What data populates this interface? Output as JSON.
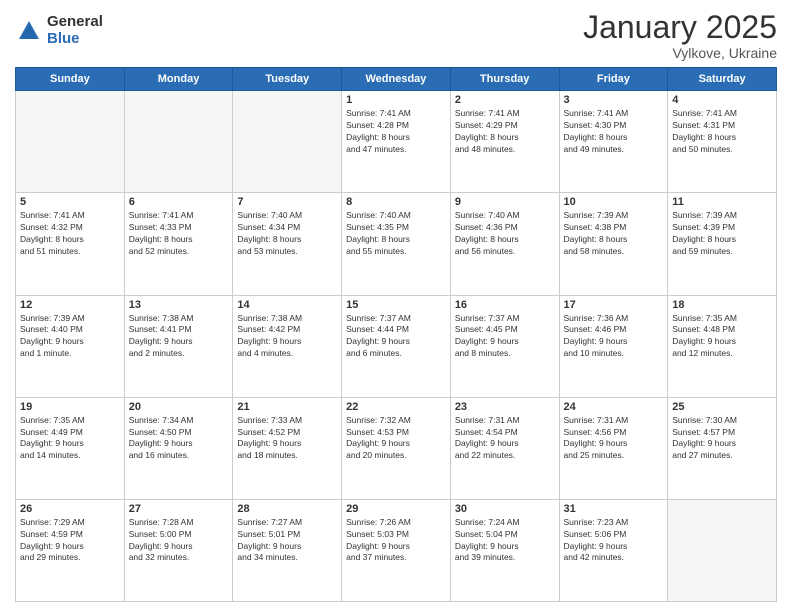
{
  "logo": {
    "general": "General",
    "blue": "Blue"
  },
  "header": {
    "month_year": "January 2025",
    "location": "Vylkove, Ukraine"
  },
  "weekdays": [
    "Sunday",
    "Monday",
    "Tuesday",
    "Wednesday",
    "Thursday",
    "Friday",
    "Saturday"
  ],
  "weeks": [
    [
      {
        "day": "",
        "info": ""
      },
      {
        "day": "",
        "info": ""
      },
      {
        "day": "",
        "info": ""
      },
      {
        "day": "1",
        "info": "Sunrise: 7:41 AM\nSunset: 4:28 PM\nDaylight: 8 hours\nand 47 minutes."
      },
      {
        "day": "2",
        "info": "Sunrise: 7:41 AM\nSunset: 4:29 PM\nDaylight: 8 hours\nand 48 minutes."
      },
      {
        "day": "3",
        "info": "Sunrise: 7:41 AM\nSunset: 4:30 PM\nDaylight: 8 hours\nand 49 minutes."
      },
      {
        "day": "4",
        "info": "Sunrise: 7:41 AM\nSunset: 4:31 PM\nDaylight: 8 hours\nand 50 minutes."
      }
    ],
    [
      {
        "day": "5",
        "info": "Sunrise: 7:41 AM\nSunset: 4:32 PM\nDaylight: 8 hours\nand 51 minutes."
      },
      {
        "day": "6",
        "info": "Sunrise: 7:41 AM\nSunset: 4:33 PM\nDaylight: 8 hours\nand 52 minutes."
      },
      {
        "day": "7",
        "info": "Sunrise: 7:40 AM\nSunset: 4:34 PM\nDaylight: 8 hours\nand 53 minutes."
      },
      {
        "day": "8",
        "info": "Sunrise: 7:40 AM\nSunset: 4:35 PM\nDaylight: 8 hours\nand 55 minutes."
      },
      {
        "day": "9",
        "info": "Sunrise: 7:40 AM\nSunset: 4:36 PM\nDaylight: 8 hours\nand 56 minutes."
      },
      {
        "day": "10",
        "info": "Sunrise: 7:39 AM\nSunset: 4:38 PM\nDaylight: 8 hours\nand 58 minutes."
      },
      {
        "day": "11",
        "info": "Sunrise: 7:39 AM\nSunset: 4:39 PM\nDaylight: 8 hours\nand 59 minutes."
      }
    ],
    [
      {
        "day": "12",
        "info": "Sunrise: 7:39 AM\nSunset: 4:40 PM\nDaylight: 9 hours\nand 1 minute."
      },
      {
        "day": "13",
        "info": "Sunrise: 7:38 AM\nSunset: 4:41 PM\nDaylight: 9 hours\nand 2 minutes."
      },
      {
        "day": "14",
        "info": "Sunrise: 7:38 AM\nSunset: 4:42 PM\nDaylight: 9 hours\nand 4 minutes."
      },
      {
        "day": "15",
        "info": "Sunrise: 7:37 AM\nSunset: 4:44 PM\nDaylight: 9 hours\nand 6 minutes."
      },
      {
        "day": "16",
        "info": "Sunrise: 7:37 AM\nSunset: 4:45 PM\nDaylight: 9 hours\nand 8 minutes."
      },
      {
        "day": "17",
        "info": "Sunrise: 7:36 AM\nSunset: 4:46 PM\nDaylight: 9 hours\nand 10 minutes."
      },
      {
        "day": "18",
        "info": "Sunrise: 7:35 AM\nSunset: 4:48 PM\nDaylight: 9 hours\nand 12 minutes."
      }
    ],
    [
      {
        "day": "19",
        "info": "Sunrise: 7:35 AM\nSunset: 4:49 PM\nDaylight: 9 hours\nand 14 minutes."
      },
      {
        "day": "20",
        "info": "Sunrise: 7:34 AM\nSunset: 4:50 PM\nDaylight: 9 hours\nand 16 minutes."
      },
      {
        "day": "21",
        "info": "Sunrise: 7:33 AM\nSunset: 4:52 PM\nDaylight: 9 hours\nand 18 minutes."
      },
      {
        "day": "22",
        "info": "Sunrise: 7:32 AM\nSunset: 4:53 PM\nDaylight: 9 hours\nand 20 minutes."
      },
      {
        "day": "23",
        "info": "Sunrise: 7:31 AM\nSunset: 4:54 PM\nDaylight: 9 hours\nand 22 minutes."
      },
      {
        "day": "24",
        "info": "Sunrise: 7:31 AM\nSunset: 4:56 PM\nDaylight: 9 hours\nand 25 minutes."
      },
      {
        "day": "25",
        "info": "Sunrise: 7:30 AM\nSunset: 4:57 PM\nDaylight: 9 hours\nand 27 minutes."
      }
    ],
    [
      {
        "day": "26",
        "info": "Sunrise: 7:29 AM\nSunset: 4:59 PM\nDaylight: 9 hours\nand 29 minutes."
      },
      {
        "day": "27",
        "info": "Sunrise: 7:28 AM\nSunset: 5:00 PM\nDaylight: 9 hours\nand 32 minutes."
      },
      {
        "day": "28",
        "info": "Sunrise: 7:27 AM\nSunset: 5:01 PM\nDaylight: 9 hours\nand 34 minutes."
      },
      {
        "day": "29",
        "info": "Sunrise: 7:26 AM\nSunset: 5:03 PM\nDaylight: 9 hours\nand 37 minutes."
      },
      {
        "day": "30",
        "info": "Sunrise: 7:24 AM\nSunset: 5:04 PM\nDaylight: 9 hours\nand 39 minutes."
      },
      {
        "day": "31",
        "info": "Sunrise: 7:23 AM\nSunset: 5:06 PM\nDaylight: 9 hours\nand 42 minutes."
      },
      {
        "day": "",
        "info": ""
      }
    ]
  ]
}
